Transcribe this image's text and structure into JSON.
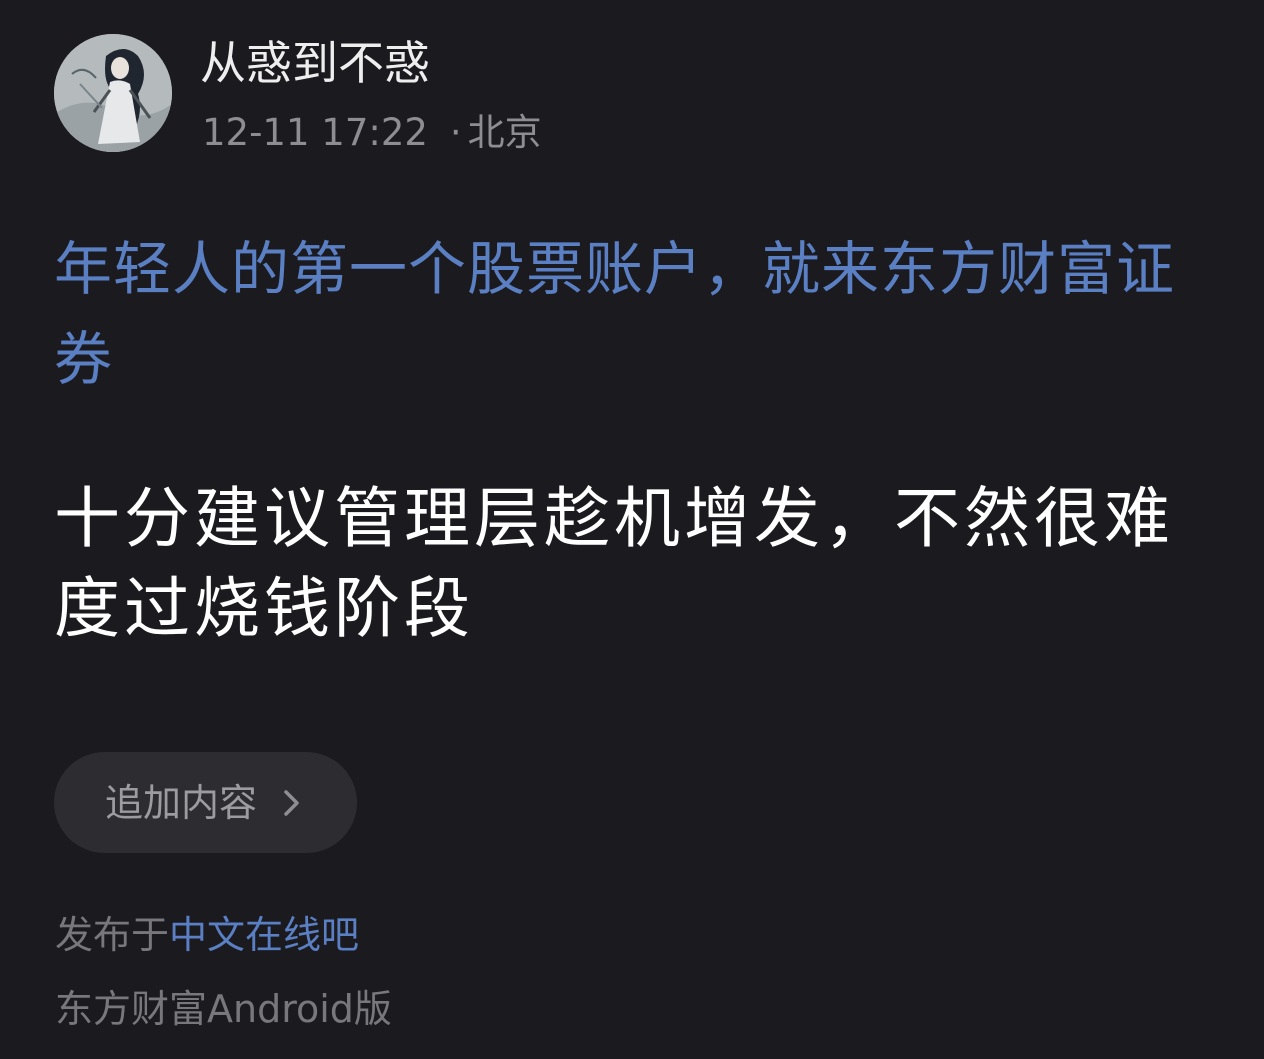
{
  "post": {
    "author": {
      "name": "从惑到不惑",
      "avatar_icon": "avatar-illustration"
    },
    "timestamp": "12-11 17:22",
    "separator": "·",
    "location": "北京",
    "link_title": "年轻人的第一个股票账户，就来东方财富证券",
    "content": "十分建议管理层趁机增发，不然很难度过烧钱阶段"
  },
  "actions": {
    "append_label": "追加内容",
    "append_icon": "chevron-right-icon"
  },
  "footer": {
    "published_prefix": "发布于",
    "forum_name": "中文在线吧",
    "client": "东方财富Android版"
  },
  "colors": {
    "background": "#1b1a1f",
    "link": "#5a7fc3",
    "button_bg": "#2d2c31"
  }
}
